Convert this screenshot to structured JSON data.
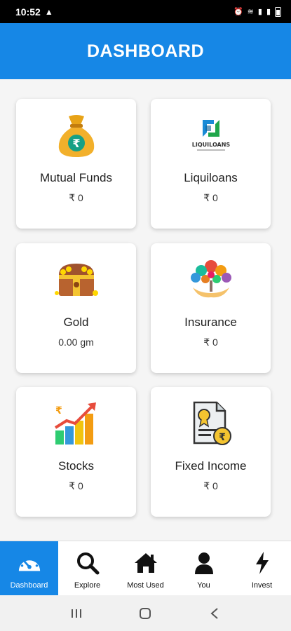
{
  "status_bar": {
    "time": "10:52",
    "warning_icon": "warning-icon"
  },
  "header": {
    "title": "DASHBOARD"
  },
  "cards": [
    {
      "title": "Mutual Funds",
      "value": "₹ 0",
      "icon": "money-bag-icon"
    },
    {
      "title": "Liquiloans",
      "value": "₹ 0",
      "icon": "liquiloans-logo",
      "logo_text": "LIQUILOANS"
    },
    {
      "title": "Gold",
      "value": "0.00 gm",
      "icon": "treasure-chest-icon"
    },
    {
      "title": "Insurance",
      "value": "₹ 0",
      "icon": "insurance-tree-icon"
    },
    {
      "title": "Stocks",
      "value": "₹ 0",
      "icon": "stocks-chart-icon"
    },
    {
      "title": "Fixed Income",
      "value": "₹ 0",
      "icon": "certificate-icon"
    }
  ],
  "bottom_nav": [
    {
      "label": "Dashboard",
      "icon": "speedometer-icon",
      "active": true
    },
    {
      "label": "Explore",
      "icon": "search-icon",
      "active": false
    },
    {
      "label": "Most Used",
      "icon": "home-icon",
      "active": false
    },
    {
      "label": "You",
      "icon": "user-icon",
      "active": false
    },
    {
      "label": "Invest",
      "icon": "lightning-icon",
      "active": false
    }
  ],
  "colors": {
    "primary": "#1687e6",
    "background": "#f5f5f5"
  }
}
